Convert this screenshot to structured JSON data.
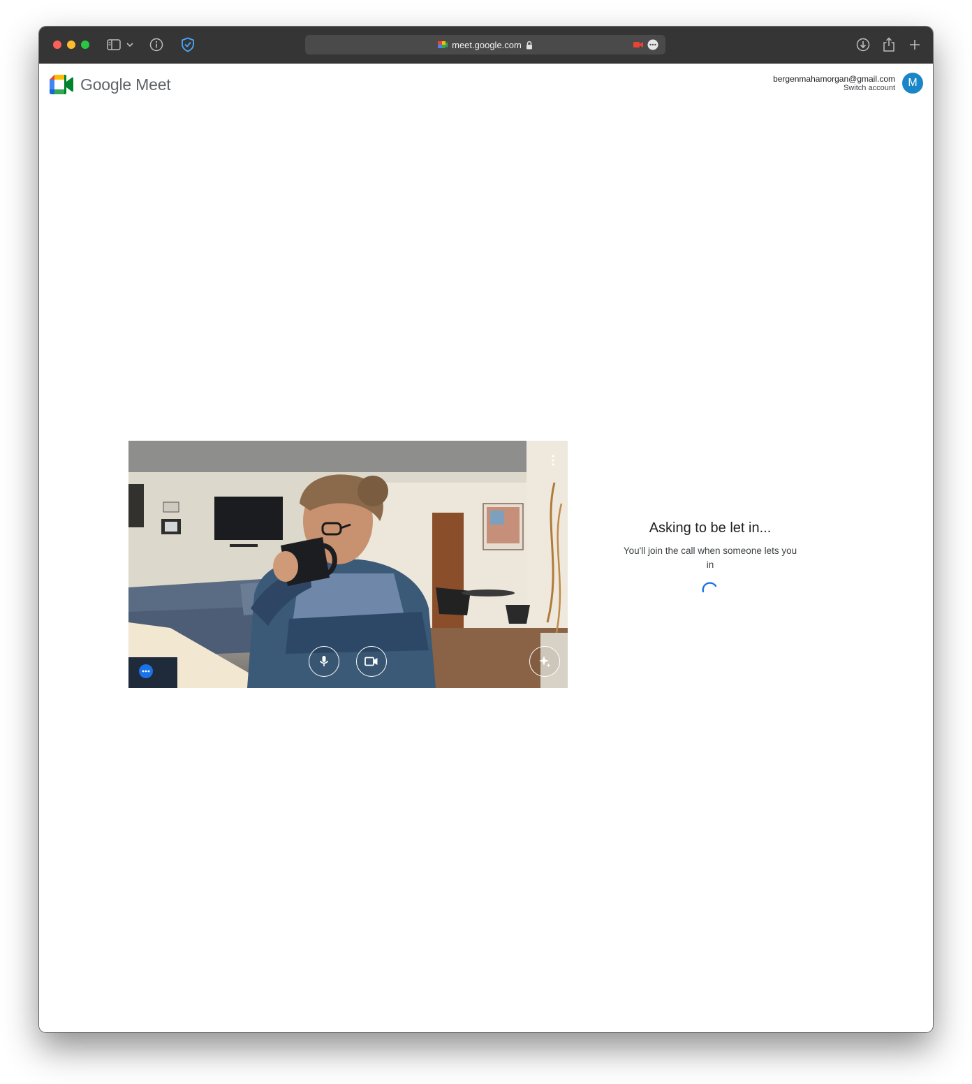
{
  "browser": {
    "url": "meet.google.com",
    "icons": {
      "sidebar": "sidebar-icon",
      "chevron": "chevron-down-icon",
      "info": "info-icon",
      "shield": "shield-icon",
      "lock": "lock-icon",
      "camera": "camera-in-use-icon",
      "more": "more-icon",
      "download": "download-icon",
      "share": "share-icon",
      "newtab": "plus-icon"
    },
    "colors": {
      "chrome": "#353535",
      "url_bg": "#4a4a4a",
      "recording": "#ea4335"
    }
  },
  "header": {
    "brand": "Google Meet",
    "account_email": "bergenmahamorgan@gmail.com",
    "switch_account": "Switch account",
    "avatar_initial": "M",
    "avatar_color": "#1a86c8"
  },
  "preview": {
    "controls": {
      "mic": "microphone-icon",
      "camera": "video-camera-icon",
      "effects": "sparkle-icon",
      "more": "more-horizontal-icon",
      "options": "more-vertical-icon"
    }
  },
  "status": {
    "title": "Asking to be let in...",
    "message": "You'll join the call when someone lets you in",
    "accent": "#1a73e8"
  }
}
